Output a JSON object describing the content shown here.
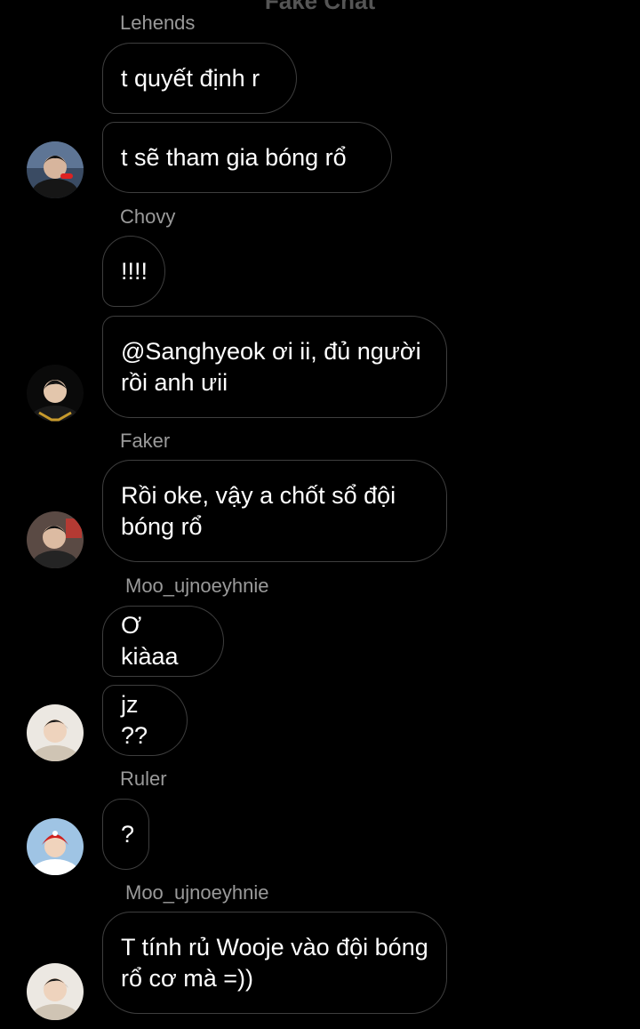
{
  "header": {
    "title": "Fake Chat"
  },
  "messages": [
    {
      "sender": "Lehends",
      "texts": [
        "t quyết định r",
        "t sẽ tham gia bóng rổ"
      ]
    },
    {
      "sender": "Chovy",
      "texts": [
        "!!!!",
        "@Sanghyeok ơi ii, đủ người rồi anh ưii"
      ]
    },
    {
      "sender": "Faker",
      "texts": [
        "Rồi oke, vậy a chốt sổ đội bóng rổ"
      ]
    },
    {
      "sender": "Moo_ujnoeyhnie",
      "texts": [
        "Ơ kiàaa",
        "jz ??"
      ]
    },
    {
      "sender": "Ruler",
      "texts": [
        "?"
      ]
    },
    {
      "sender": "Moo_ujnoeyhnie",
      "texts": [
        "T tính rủ Wooje vào đội bóng rổ cơ mà =))"
      ]
    }
  ],
  "colors": {
    "background": "#000000",
    "bubble_border": "#3e3e3e",
    "name_text": "#9a9a9a",
    "message_text": "#ffffff"
  }
}
